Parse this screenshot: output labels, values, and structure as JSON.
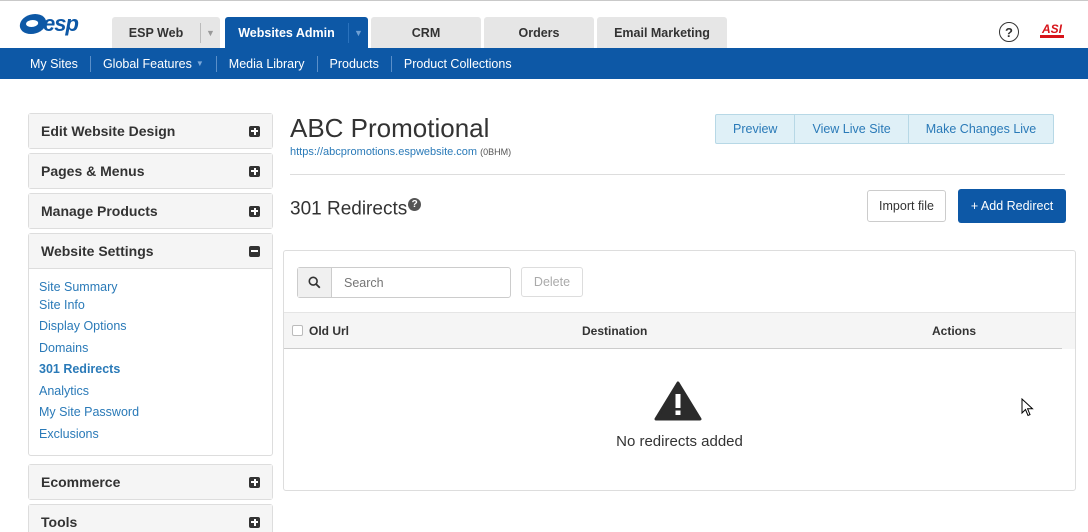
{
  "top_tabs": {
    "logo": "esp",
    "tabs": [
      {
        "label": "ESP Web",
        "has_dropdown": true,
        "active": false
      },
      {
        "label": "Websites Admin",
        "has_dropdown": true,
        "active": true
      },
      {
        "label": "CRM",
        "active": false
      },
      {
        "label": "Orders",
        "active": false
      },
      {
        "label": "Email Marketing",
        "active": false
      }
    ],
    "help_icon": "question-circle-icon",
    "brand_badge": "ASI"
  },
  "sub_nav": {
    "items": [
      "My Sites",
      "Global Features",
      "Media Library",
      "Products",
      "Product Collections"
    ]
  },
  "sidebar": {
    "panels": [
      {
        "title": "Edit Website Design",
        "icon": "plus-square-icon"
      },
      {
        "title": "Pages & Menus",
        "icon": "plus-square-icon"
      },
      {
        "title": "Manage Products",
        "icon": "plus-square-icon"
      },
      {
        "title": "Website Settings",
        "icon": "minus-square-icon",
        "links": [
          "Site Summary",
          "Site Info",
          "Display Options",
          "Domains",
          "301 Redirects",
          "Analytics",
          "My Site Password",
          "Exclusions"
        ],
        "active_link": "301 Redirects"
      },
      {
        "title": "Ecommerce",
        "icon": "plus-square-icon"
      },
      {
        "title": "Tools",
        "icon": "plus-square-icon"
      }
    ]
  },
  "site": {
    "title": "ABC Promotional",
    "url": "https://abcpromotions.espwebsite.com",
    "code": "(0BHM)"
  },
  "site_actions": [
    "Preview",
    "View Live Site",
    "Make Changes Live"
  ],
  "section": {
    "title": "301 Redirects",
    "import_label": "Import file",
    "add_label": "+ Add Redirect"
  },
  "table": {
    "search_placeholder": "Search",
    "delete_label": "Delete",
    "columns": [
      "Old Url",
      "Destination",
      "Actions"
    ],
    "empty_message": "No redirects added",
    "empty_icon": "warning-triangle-icon"
  },
  "colors": {
    "brand_blue": "#0d58a6",
    "link_blue": "#2a7ab8",
    "asi_red": "#d7141a"
  }
}
